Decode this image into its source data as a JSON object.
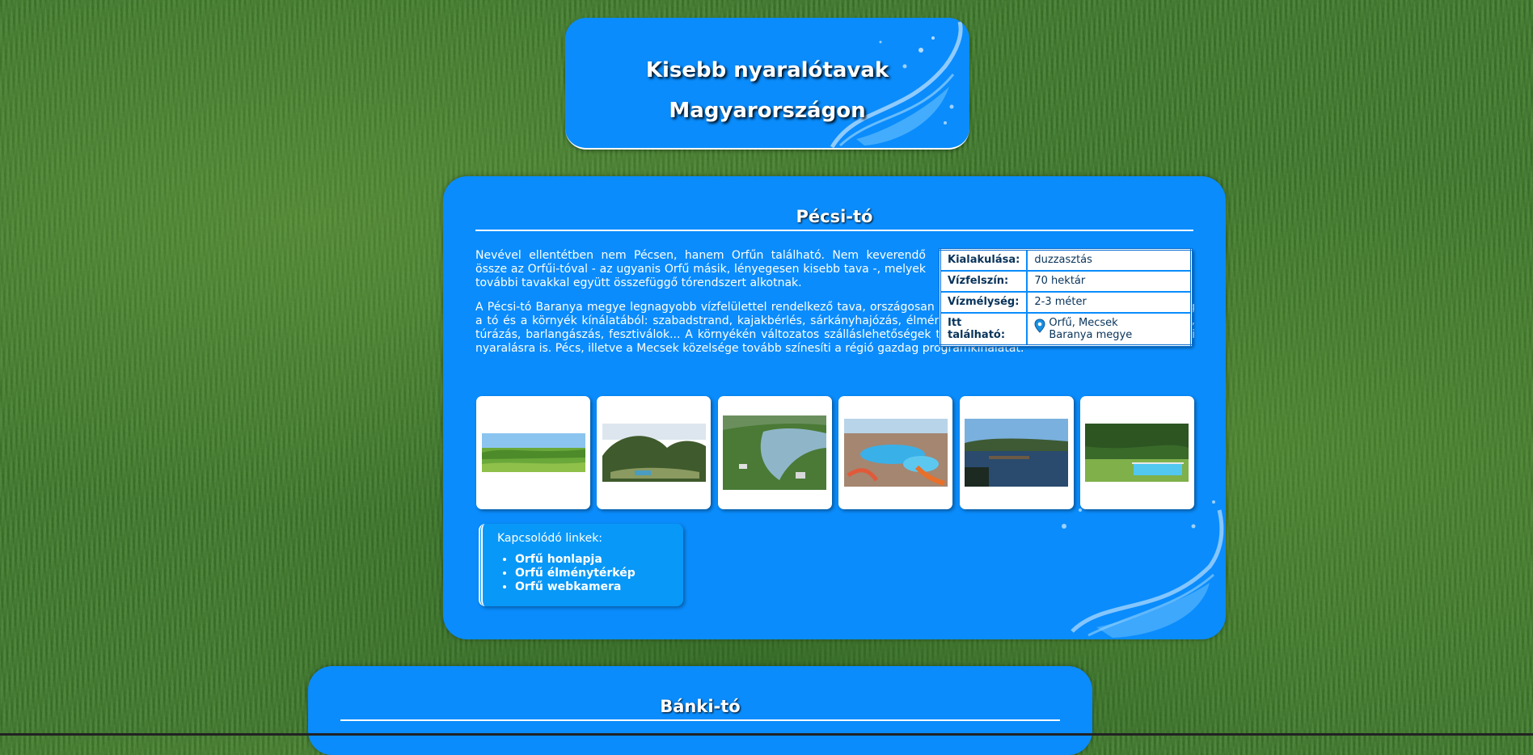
{
  "header": {
    "title_line1": "Kisebb nyaralótavak",
    "title_line2": "Magyarországon"
  },
  "lake1": {
    "title": "Pécsi-tó",
    "paragraph1": "Nevével ellentétben nem Pécsen, hanem Orfűn található. Nem keverendő össze az Orfűi-tóval - az ugyanis Orfű másik, lényegesen kisebb tava -, melyek további tavakkal együtt összefüggő tórendszert alkotnak.",
    "paragraph2": "A Pécsi-tó Baranya megye legnagyobb vízfelülettel rendelkező tava, országosan kedvelt üdülőterület. Csak néhány lehetőség a tó és a környék kínálatából: szabadstrand, kajakbérlés, sárkányhajózás, élményfürdő, kerékpárbérlés, horgászás, lovaglás, túrázás, barlangászás, fesztiválok... A környékén változatos szálláslehetőségek teremtenek lehetőséget akár hosszabb itteni nyaralásra is. Pécs, illetve a Mecsek közelsége tovább színesíti a régió gazdag programkínálatát.",
    "info": [
      {
        "label": "Kialakulása:",
        "value": "duzzasztás"
      },
      {
        "label": "Vízfelszín:",
        "value": "70 hektár"
      },
      {
        "label": "Vízmélység:",
        "value": "2-3 méter"
      },
      {
        "label": "Itt található:",
        "value_line1": "Orfű, Mecsek",
        "value_line2": "Baranya megye",
        "icon": "location-pin-icon"
      }
    ],
    "links_title": "Kapcsolódó linkek:",
    "links": [
      "Orfű honlapja",
      "Orfű élménytérkép",
      "Orfű webkamera"
    ]
  },
  "lake2": {
    "title": "Bánki-tó"
  },
  "colors": {
    "panel": "#0a8cfc",
    "text": "#ffffff",
    "table_text": "#08335a"
  }
}
